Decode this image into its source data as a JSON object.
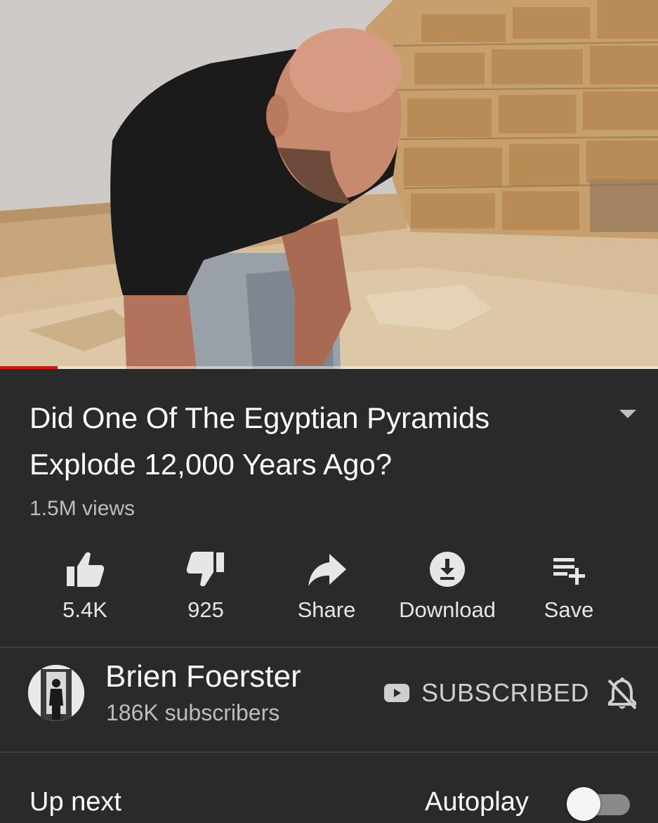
{
  "video": {
    "progress_fraction": 0.088,
    "title": "Did One Of The Egyptian Pyramids Explode 12,000 Years Ago?",
    "views": "1.5M views"
  },
  "actions": {
    "like": {
      "icon": "thumb-up-icon",
      "label": "5.4K"
    },
    "dislike": {
      "icon": "thumb-down-icon",
      "label": "925"
    },
    "share": {
      "icon": "share-icon",
      "label": "Share"
    },
    "download": {
      "icon": "download-icon",
      "label": "Download"
    },
    "save": {
      "icon": "playlist-add-icon",
      "label": "Save"
    }
  },
  "channel": {
    "name": "Brien Foerster",
    "subscribers": "186K subscribers",
    "subscribe_label": "SUBSCRIBED"
  },
  "upnext": {
    "label": "Up next",
    "autoplay_label": "Autoplay",
    "autoplay_on": false
  },
  "colors": {
    "background": "#2a2a2a",
    "progress": "#ff0000",
    "icon": "#e6e6e6"
  }
}
